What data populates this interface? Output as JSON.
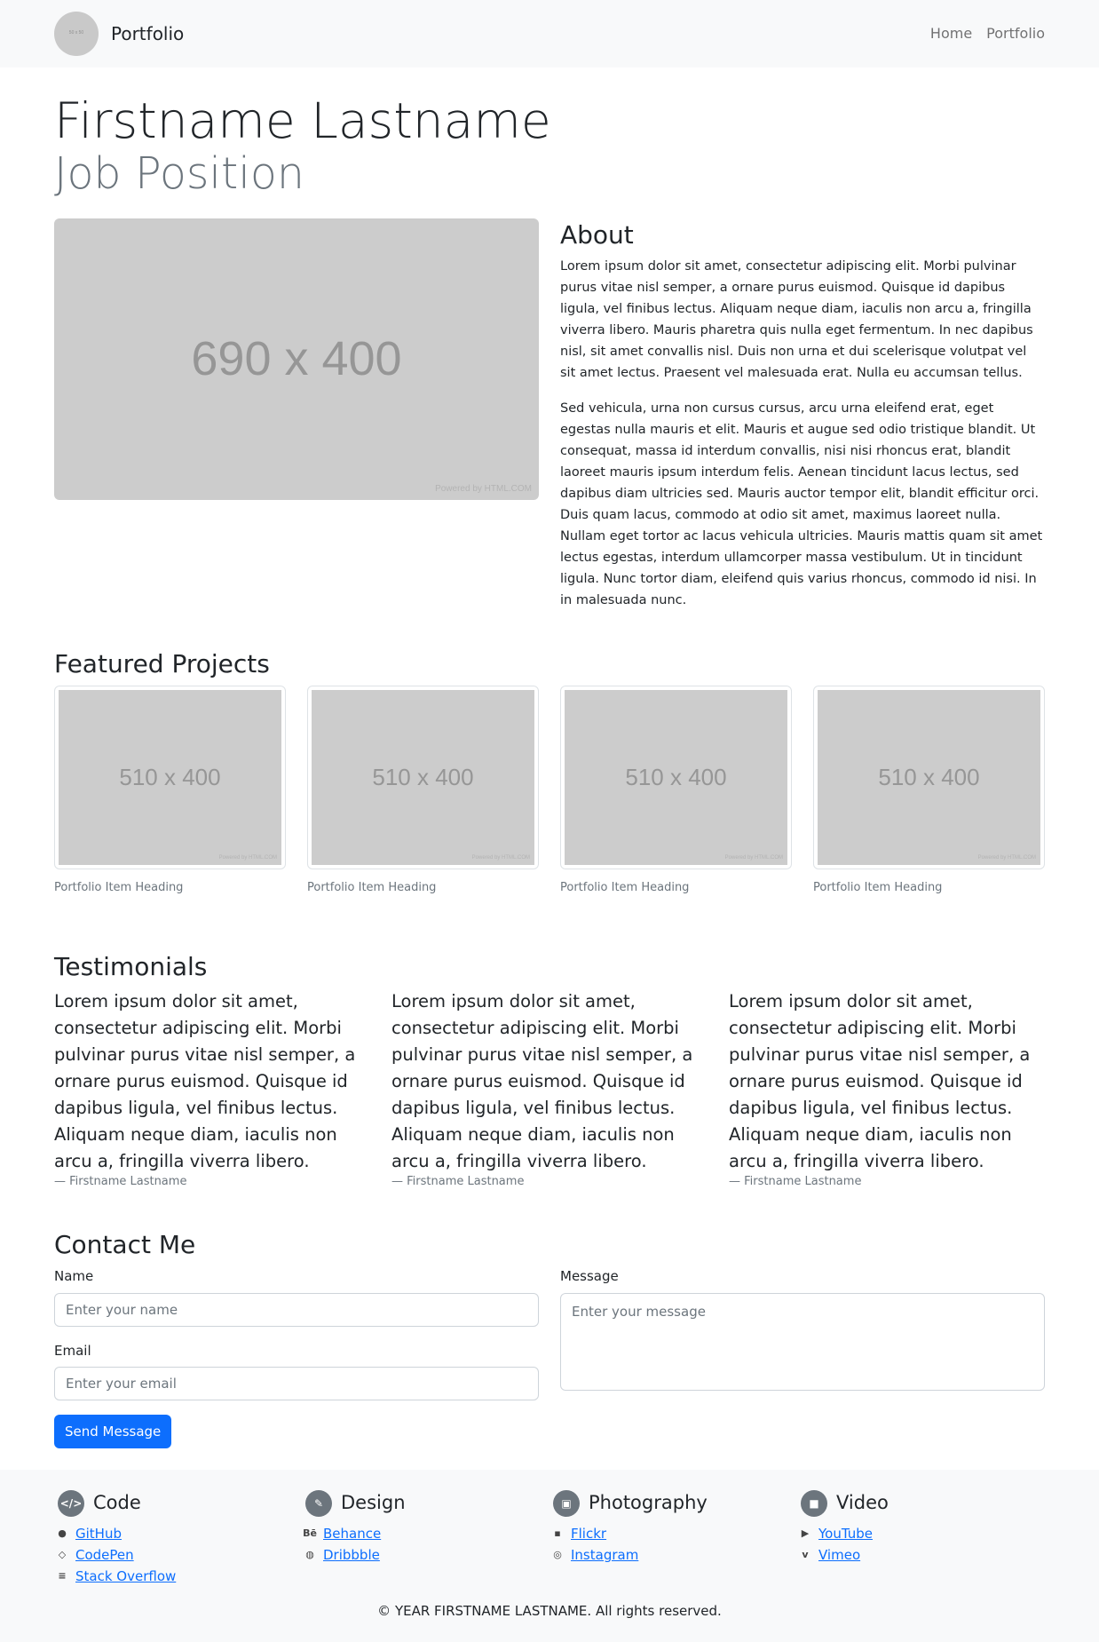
{
  "navbar": {
    "logo_text": "50 x 50",
    "brand": "Portfolio",
    "links": [
      "Home",
      "Portfolio"
    ]
  },
  "hero": {
    "name": "Firstname Lastname",
    "position": "Job Position",
    "image_label": "690 x 400",
    "image_credit": "Powered by HTML.COM"
  },
  "about": {
    "title": "About",
    "paragraphs": [
      "Lorem ipsum dolor sit amet, consectetur adipiscing elit. Morbi pulvinar purus vitae nisl semper, a ornare purus euismod. Quisque id dapibus ligula, vel finibus lectus. Aliquam neque diam, iaculis non arcu a, fringilla viverra libero. Mauris pharetra quis nulla eget fermentum. In nec dapibus nisl, sit amet convallis nisl. Duis non urna et dui scelerisque volutpat vel sit amet lectus. Praesent vel malesuada erat. Nulla eu accumsan tellus.",
      "Sed vehicula, urna non cursus cursus, arcu urna eleifend erat, eget egestas nulla mauris et elit. Mauris et augue sed odio tristique blandit. Ut consequat, massa id interdum convallis, nisi nisi rhoncus erat, blandit laoreet mauris ipsum interdum felis. Aenean tincidunt lacus lectus, sed dapibus diam ultricies sed. Mauris auctor tempor elit, blandit efficitur orci. Duis quam lacus, commodo at odio sit amet, maximus laoreet nulla. Nullam eget tortor ac lacus vehicula ultricies. Mauris mattis quam sit amet lectus egestas, interdum ullamcorper massa vestibulum. Ut in tincidunt ligula. Nunc tortor diam, eleifend quis varius rhoncus, commodo id nisi. In in malesuada nunc."
    ]
  },
  "projects": {
    "title": "Featured Projects",
    "items": [
      {
        "image_label": "510 x 400",
        "image_credit": "Powered by HTML.COM",
        "caption": "Portfolio Item Heading"
      },
      {
        "image_label": "510 x 400",
        "image_credit": "Powered by HTML.COM",
        "caption": "Portfolio Item Heading"
      },
      {
        "image_label": "510 x 400",
        "image_credit": "Powered by HTML.COM",
        "caption": "Portfolio Item Heading"
      },
      {
        "image_label": "510 x 400",
        "image_credit": "Powered by HTML.COM",
        "caption": "Portfolio Item Heading"
      }
    ]
  },
  "testimonials": {
    "title": "Testimonials",
    "items": [
      {
        "quote": "Lorem ipsum dolor sit amet, consectetur adipiscing elit. Morbi pulvinar purus vitae nisl semper, a ornare purus euismod. Quisque id dapibus ligula, vel finibus lectus. Aliquam neque diam, iaculis non arcu a, fringilla viverra libero.",
        "author": "— Firstname Lastname"
      },
      {
        "quote": "Lorem ipsum dolor sit amet, consectetur adipiscing elit. Morbi pulvinar purus vitae nisl semper, a ornare purus euismod. Quisque id dapibus ligula, vel finibus lectus. Aliquam neque diam, iaculis non arcu a, fringilla viverra libero.",
        "author": "— Firstname Lastname"
      },
      {
        "quote": "Lorem ipsum dolor sit amet, consectetur adipiscing elit. Morbi pulvinar purus vitae nisl semper, a ornare purus euismod. Quisque id dapibus ligula, vel finibus lectus. Aliquam neque diam, iaculis non arcu a, fringilla viverra libero.",
        "author": "— Firstname Lastname"
      }
    ]
  },
  "contact": {
    "title": "Contact Me",
    "name_label": "Name",
    "name_placeholder": "Enter your name",
    "email_label": "Email",
    "email_placeholder": "Enter your email",
    "message_label": "Message",
    "message_placeholder": "Enter your message",
    "submit_label": "Send Message"
  },
  "footer": {
    "columns": [
      {
        "title": "Code",
        "icon": "code-icon",
        "links": [
          {
            "label": "GitHub",
            "icon": "github-icon"
          },
          {
            "label": "CodePen",
            "icon": "codepen-icon"
          },
          {
            "label": "Stack Overflow",
            "icon": "stack-overflow-icon"
          }
        ]
      },
      {
        "title": "Design",
        "icon": "brush-icon",
        "links": [
          {
            "label": "Behance",
            "icon": "behance-icon"
          },
          {
            "label": "Dribbble",
            "icon": "dribbble-icon"
          }
        ]
      },
      {
        "title": "Photography",
        "icon": "image-icon",
        "links": [
          {
            "label": "Flickr",
            "icon": "flickr-icon"
          },
          {
            "label": "Instagram",
            "icon": "instagram-icon"
          }
        ]
      },
      {
        "title": "Video",
        "icon": "camera-video-icon",
        "links": [
          {
            "label": "YouTube",
            "icon": "youtube-icon"
          },
          {
            "label": "Vimeo",
            "icon": "vimeo-icon"
          }
        ]
      }
    ],
    "copyright": "© YEAR FIRSTNAME LASTNAME. All rights reserved."
  },
  "colors": {
    "primary": "#0d6efd",
    "muted": "#6c757d",
    "navbar_bg": "#f8f9fa",
    "placeholder_bg": "#cccccc"
  }
}
